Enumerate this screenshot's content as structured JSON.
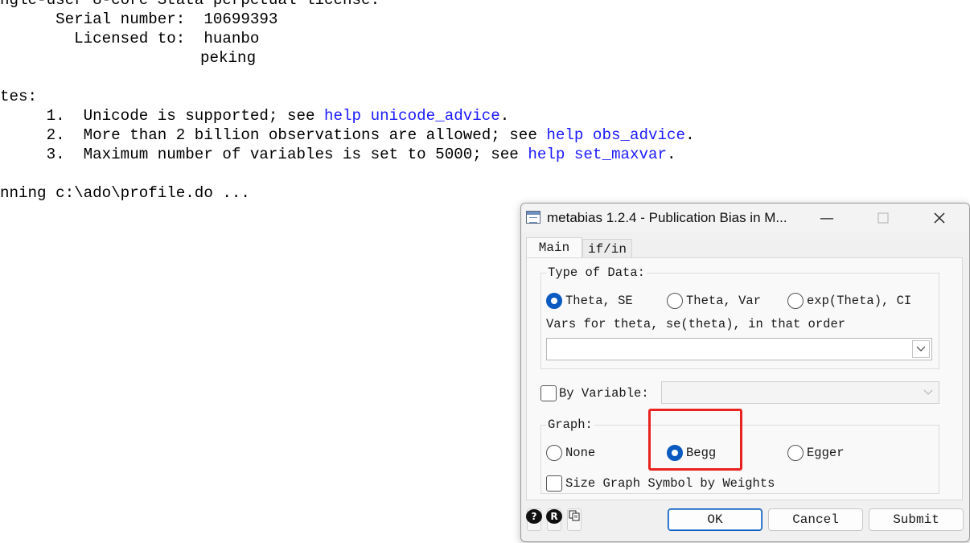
{
  "console": {
    "line1": "ngle-user 8-core Stata perpetual license:",
    "serial_label": "      Serial number:  ",
    "serial_value": "10699393",
    "licensed_label": "        Licensed to:  ",
    "licensed_name": "huanbo",
    "licensed_org": "peking",
    "notes_header": "tes:",
    "note1_prefix": "     1.  Unicode is supported; see ",
    "note1_link": "help unicode_advice",
    "note1_suffix": ".",
    "note2_prefix": "     2.  More than 2 billion observations are allowed; see ",
    "note2_link": "help obs_advice",
    "note2_suffix": ".",
    "note3_prefix": "     3.  Maximum number of variables is set to 5000; see ",
    "note3_link": "help set_maxvar",
    "note3_suffix": ".",
    "running": "nning c:\\ado\\profile.do ..."
  },
  "dialog": {
    "title": "metabias 1.2.4 - Publication Bias in M...",
    "tabs": [
      {
        "label": "Main",
        "active": true
      },
      {
        "label": "if/in",
        "active": false
      }
    ],
    "type_of_data": {
      "legend": "Type of Data:",
      "options": [
        {
          "label": "Theta, SE",
          "selected": true
        },
        {
          "label": "Theta, Var",
          "selected": false
        },
        {
          "label": "exp(Theta), CI",
          "selected": false
        }
      ],
      "vars_label": "Vars for theta, se(theta), in that order",
      "vars_value": ""
    },
    "by_variable": {
      "label": "By Variable:",
      "checked": false,
      "value": ""
    },
    "graph": {
      "legend": "Graph:",
      "options": [
        {
          "label": "None",
          "selected": false
        },
        {
          "label": "Begg",
          "selected": true
        },
        {
          "label": "Egger",
          "selected": false
        }
      ],
      "size_label": "Size Graph Symbol by Weights",
      "size_checked": false
    },
    "footer": {
      "help_glyph": "?",
      "reset_glyph": "R",
      "buttons": {
        "ok": "OK",
        "cancel": "Cancel",
        "submit": "Submit"
      }
    }
  },
  "colors": {
    "link": "#1a1aff",
    "accent": "#0a5ac2",
    "highlight": "#e8231f"
  }
}
